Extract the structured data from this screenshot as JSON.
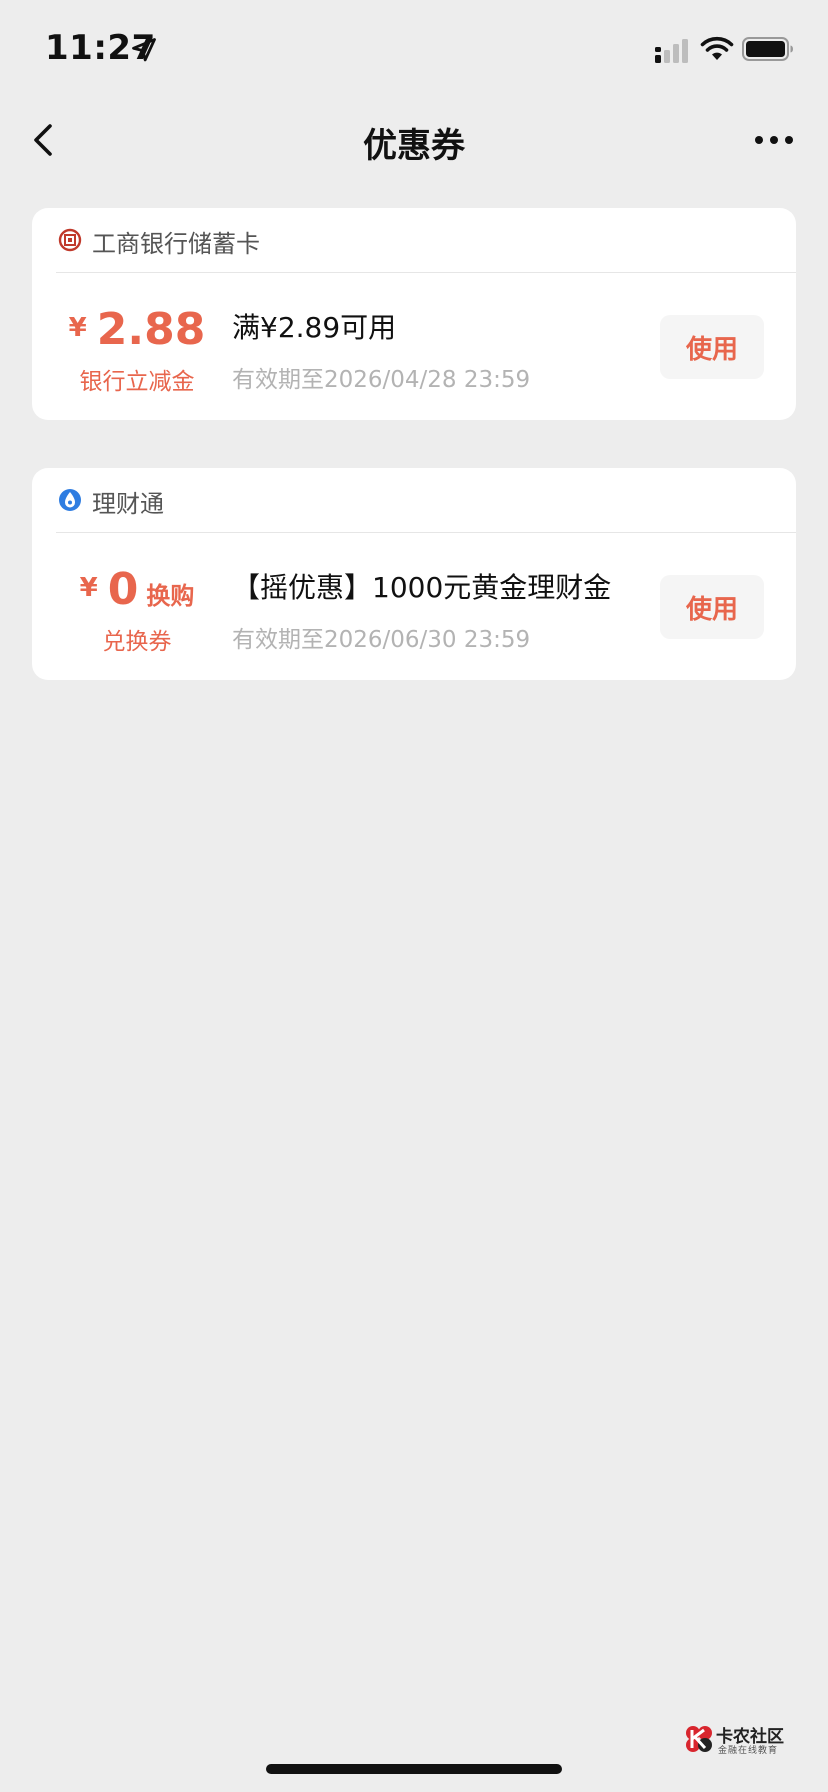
{
  "status_bar": {
    "time": "11:27"
  },
  "nav": {
    "title": "优惠券"
  },
  "coupons": [
    {
      "issuer": "工商银行储蓄卡",
      "issuer_icon": "icbc-logo-icon",
      "currency": "¥",
      "amount": "2.88",
      "amount_suffix": "",
      "amount_type": "银行立减金",
      "title": "满¥2.89可用",
      "expiry": "有效期至2026/04/28 23:59",
      "button_label": "使用"
    },
    {
      "issuer": "理财通",
      "issuer_icon": "licaitong-logo-icon",
      "currency": "¥",
      "amount": "0",
      "amount_suffix": "换购",
      "amount_type": "兑换券",
      "title": "【摇优惠】1000元黄金理财金",
      "expiry": "有效期至2026/06/30 23:59",
      "button_label": "使用"
    }
  ],
  "watermark": {
    "title": "卡农社区",
    "subtitle": "金融在线教育"
  },
  "colors": {
    "accent": "#e8664d",
    "background": "#ededed",
    "card": "#ffffff",
    "muted_text": "#b3b3b3"
  }
}
